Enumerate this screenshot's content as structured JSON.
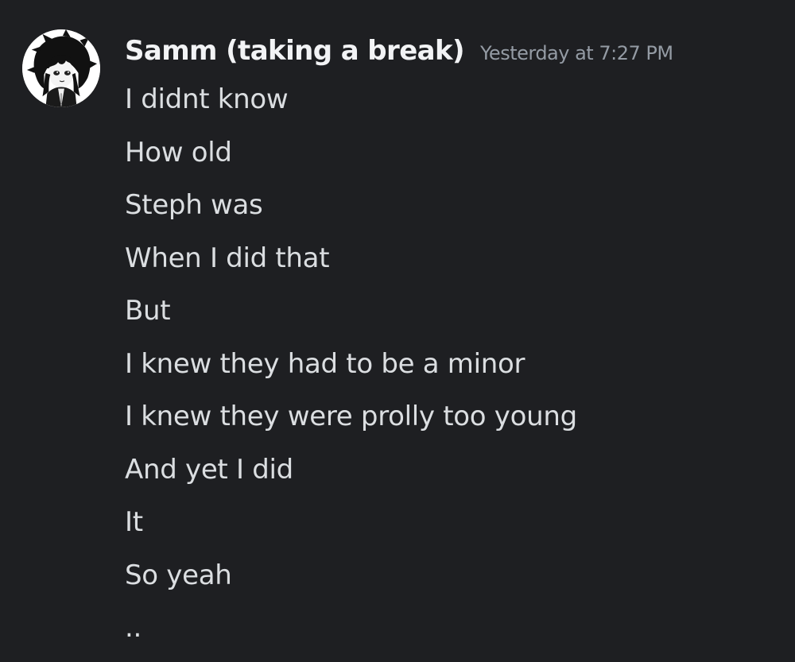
{
  "message": {
    "author": {
      "name": "Samm (taking a break)",
      "avatar_icon": "anime-avatar-icon"
    },
    "timestamp": "Yesterday at 7:27 PM",
    "lines": [
      "I didnt know",
      "How old",
      "Steph was",
      "When I did that",
      "But",
      "I knew they had to be a minor",
      "I knew they were prolly too young",
      "And yet I did",
      "It",
      "So yeah",
      ".."
    ]
  },
  "colors": {
    "background": "#1e1f22",
    "username": "#f2f3f5",
    "timestamp": "#949ba4",
    "text": "#dbdee1"
  }
}
